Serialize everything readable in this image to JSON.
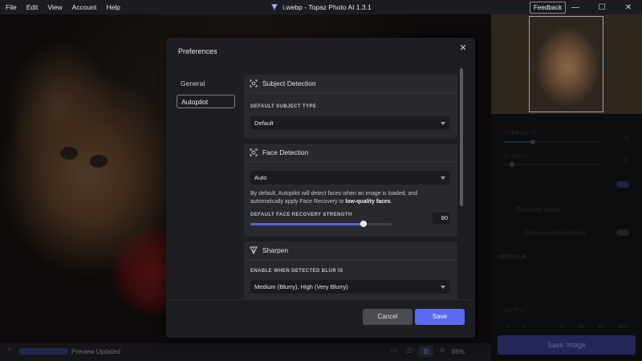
{
  "window": {
    "title": "i.webp - Topaz Photo AI 1.3.1",
    "menu": [
      "File",
      "Edit",
      "View",
      "Account",
      "Help"
    ],
    "feedback_label": "Feedback",
    "minimize_glyph": "—",
    "maximize_glyph": "☐",
    "close_glyph": "✕"
  },
  "status_bar": {
    "text": "Preview Updated",
    "zoom": "85%"
  },
  "right_panel": {
    "strength_label": "STRENGTH",
    "strength_value": "20",
    "clarity_label": "CLARITY",
    "clarity_value": "0",
    "remove_noise_label": "Remove Noise",
    "enhance_resolution_label": "Enhance Resolution",
    "upscale_label": "UPSCALE",
    "output_label": "OUTPUT",
    "scale_options": [
      "1",
      "2",
      "1x",
      "2x",
      "4x",
      "Max"
    ],
    "save_image_label": "Save Image"
  },
  "dialog": {
    "title": "Preferences",
    "nav": [
      {
        "label": "General",
        "active": false
      },
      {
        "label": "Autopilot",
        "active": true
      }
    ],
    "subject_detection": {
      "header": "Subject Detection",
      "field_label": "DEFAULT SUBJECT TYPE",
      "value": "Default"
    },
    "face_detection": {
      "header": "Face Detection",
      "value": "Auto",
      "description_1": "By default, Autopilot will detect faces when an image is loaded, and automatically apply Face Recovery to ",
      "description_bold": "low-quality faces",
      "description_2": ".",
      "strength_label": "DEFAULT FACE RECOVERY STRENGTH",
      "strength_value": "80",
      "strength_fraction": 0.8
    },
    "sharpen": {
      "header": "Sharpen",
      "field_label": "ENABLE WHEN DETECTED BLUR IS",
      "value": "Medium (Blurry), High (Very Blurry)"
    },
    "cancel_label": "Cancel",
    "save_label": "Save"
  },
  "icons": {
    "app": "topaz-logo-icon",
    "subject": "subject-detect-icon",
    "face": "face-detect-icon",
    "sharpen": "sharpen-icon"
  },
  "colors": {
    "accent": "#5b6af0",
    "dialog_bg": "#1d1e22",
    "section_bg": "#28292e"
  }
}
